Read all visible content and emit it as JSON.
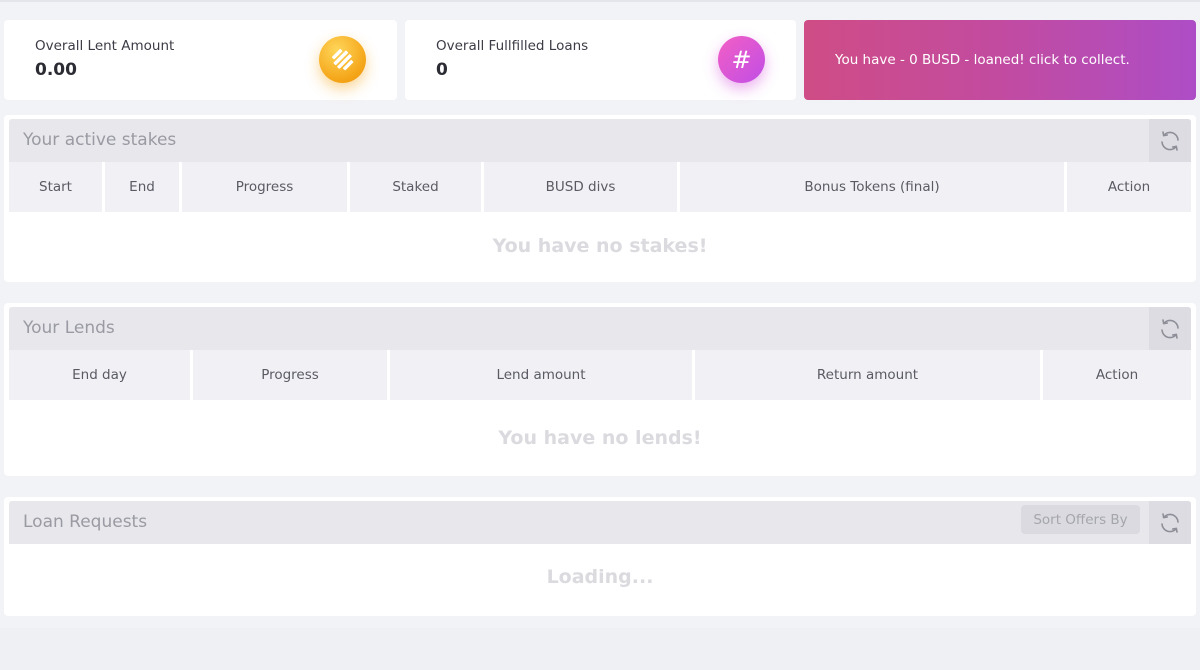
{
  "stats": {
    "lent": {
      "label": "Overall Lent Amount",
      "value": "0.00",
      "icon": "busd-coin-icon"
    },
    "loans": {
      "label": "Overall Fullfilled Loans",
      "value": "0",
      "icon": "hash-icon",
      "glyph": "#"
    }
  },
  "collect": {
    "text": "You have - 0 BUSD - loaned! click to collect."
  },
  "stakes": {
    "title": "Your active stakes",
    "columns": [
      "Start",
      "End",
      "Progress",
      "Staked",
      "BUSD divs",
      "Bonus Tokens (final)",
      "Action"
    ],
    "empty": "You have no stakes!"
  },
  "lends": {
    "title": "Your Lends",
    "columns": [
      "End day",
      "Progress",
      "Lend amount",
      "Return amount",
      "Action"
    ],
    "empty": "You have no lends!"
  },
  "requests": {
    "title": "Loan Requests",
    "sort_label": "Sort Offers By",
    "loading": "Loading..."
  },
  "colors": {
    "accent_gold": "#f4a417",
    "accent_pink": "#d24fd4",
    "collect_gradient_start": "#cf4d86",
    "collect_gradient_end": "#ad4dc6"
  }
}
